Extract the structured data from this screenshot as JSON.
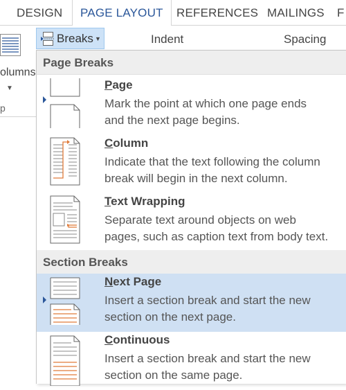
{
  "ribbon_tabs": [
    {
      "label": "DESIGN"
    },
    {
      "label": "PAGE LAYOUT",
      "active": true
    },
    {
      "label": "REFERENCES"
    },
    {
      "label": "MAILINGS"
    },
    {
      "label": "F"
    }
  ],
  "ribbon": {
    "columns_label": "olumns",
    "group_label": "p",
    "breaks_button": {
      "label": "Breaks",
      "icon": "breaks-icon"
    },
    "indent_label": "Indent",
    "spacing_label": "Spacing"
  },
  "menu": {
    "page_breaks_header": "Page Breaks",
    "section_breaks_header": "Section Breaks",
    "items": [
      {
        "id": "page",
        "accel": "P",
        "rest": "age",
        "desc_line1": "Mark the point at which one page ends",
        "desc_line2": "and the next page begins.",
        "icon": "page-break-icon"
      },
      {
        "id": "column",
        "accel": "C",
        "rest": "olumn",
        "desc_line1": "Indicate that the text following the column",
        "desc_line2": "break will begin in the next column.",
        "icon": "column-break-icon"
      },
      {
        "id": "text-wrapping",
        "accel": "T",
        "rest": "ext Wrapping",
        "desc_line1": "Separate text around objects on web",
        "desc_line2": "pages, such as caption text from body text.",
        "icon": "text-wrapping-icon"
      },
      {
        "id": "next-page",
        "accel": "N",
        "rest": "ext Page",
        "desc_line1": "Insert a section break and start the new",
        "desc_line2": "section on the next page.",
        "icon": "next-page-icon",
        "highlighted": true
      },
      {
        "id": "continuous",
        "accel": "C",
        "rest": "ontinuous",
        "desc_line1": "Insert a section break and start the new",
        "desc_line2": "section on the same page.",
        "icon": "continuous-icon"
      }
    ]
  },
  "colors": {
    "accent": "#2b579a",
    "highlight": "#cfe0f3",
    "breaks_button_bg": "#cde2f7",
    "section_header_bg": "#eeeeee",
    "icon_orange": "#e07b39"
  }
}
